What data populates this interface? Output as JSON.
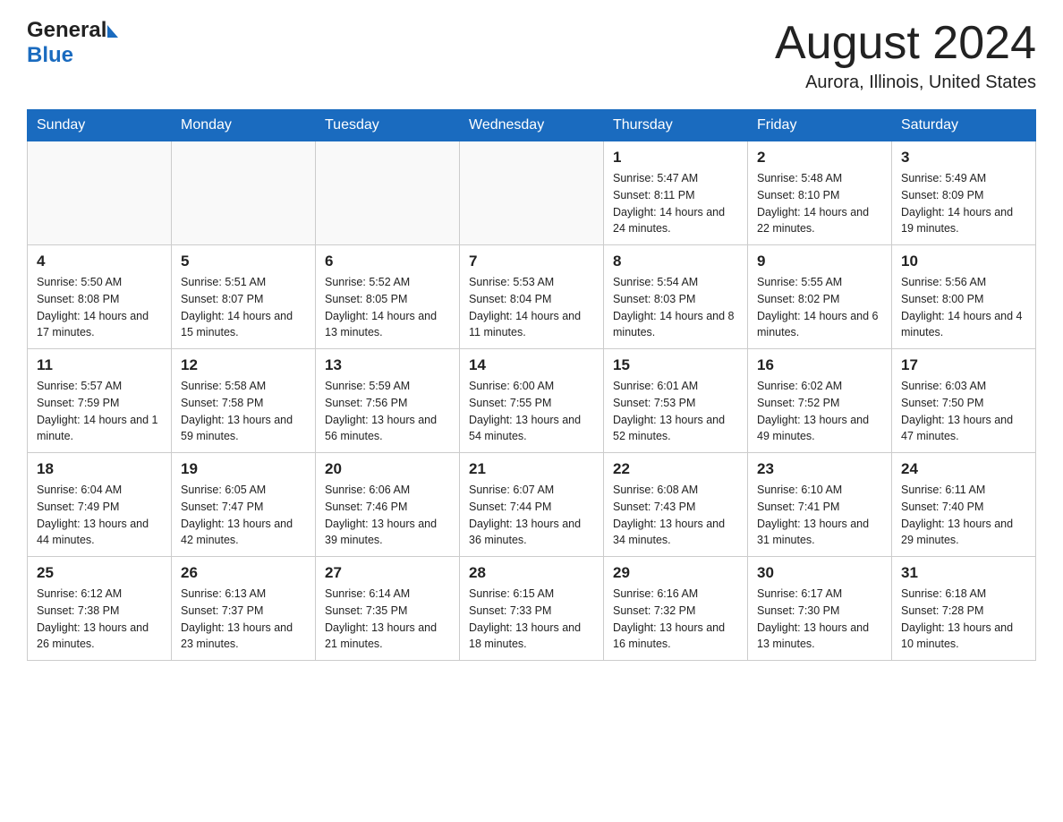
{
  "header": {
    "logo_general": "General",
    "logo_blue": "Blue",
    "month_title": "August 2024",
    "location": "Aurora, Illinois, United States"
  },
  "days_of_week": [
    "Sunday",
    "Monday",
    "Tuesday",
    "Wednesday",
    "Thursday",
    "Friday",
    "Saturday"
  ],
  "weeks": [
    {
      "days": [
        {
          "number": "",
          "info": ""
        },
        {
          "number": "",
          "info": ""
        },
        {
          "number": "",
          "info": ""
        },
        {
          "number": "",
          "info": ""
        },
        {
          "number": "1",
          "info": "Sunrise: 5:47 AM\nSunset: 8:11 PM\nDaylight: 14 hours and 24 minutes."
        },
        {
          "number": "2",
          "info": "Sunrise: 5:48 AM\nSunset: 8:10 PM\nDaylight: 14 hours and 22 minutes."
        },
        {
          "number": "3",
          "info": "Sunrise: 5:49 AM\nSunset: 8:09 PM\nDaylight: 14 hours and 19 minutes."
        }
      ]
    },
    {
      "days": [
        {
          "number": "4",
          "info": "Sunrise: 5:50 AM\nSunset: 8:08 PM\nDaylight: 14 hours and 17 minutes."
        },
        {
          "number": "5",
          "info": "Sunrise: 5:51 AM\nSunset: 8:07 PM\nDaylight: 14 hours and 15 minutes."
        },
        {
          "number": "6",
          "info": "Sunrise: 5:52 AM\nSunset: 8:05 PM\nDaylight: 14 hours and 13 minutes."
        },
        {
          "number": "7",
          "info": "Sunrise: 5:53 AM\nSunset: 8:04 PM\nDaylight: 14 hours and 11 minutes."
        },
        {
          "number": "8",
          "info": "Sunrise: 5:54 AM\nSunset: 8:03 PM\nDaylight: 14 hours and 8 minutes."
        },
        {
          "number": "9",
          "info": "Sunrise: 5:55 AM\nSunset: 8:02 PM\nDaylight: 14 hours and 6 minutes."
        },
        {
          "number": "10",
          "info": "Sunrise: 5:56 AM\nSunset: 8:00 PM\nDaylight: 14 hours and 4 minutes."
        }
      ]
    },
    {
      "days": [
        {
          "number": "11",
          "info": "Sunrise: 5:57 AM\nSunset: 7:59 PM\nDaylight: 14 hours and 1 minute."
        },
        {
          "number": "12",
          "info": "Sunrise: 5:58 AM\nSunset: 7:58 PM\nDaylight: 13 hours and 59 minutes."
        },
        {
          "number": "13",
          "info": "Sunrise: 5:59 AM\nSunset: 7:56 PM\nDaylight: 13 hours and 56 minutes."
        },
        {
          "number": "14",
          "info": "Sunrise: 6:00 AM\nSunset: 7:55 PM\nDaylight: 13 hours and 54 minutes."
        },
        {
          "number": "15",
          "info": "Sunrise: 6:01 AM\nSunset: 7:53 PM\nDaylight: 13 hours and 52 minutes."
        },
        {
          "number": "16",
          "info": "Sunrise: 6:02 AM\nSunset: 7:52 PM\nDaylight: 13 hours and 49 minutes."
        },
        {
          "number": "17",
          "info": "Sunrise: 6:03 AM\nSunset: 7:50 PM\nDaylight: 13 hours and 47 minutes."
        }
      ]
    },
    {
      "days": [
        {
          "number": "18",
          "info": "Sunrise: 6:04 AM\nSunset: 7:49 PM\nDaylight: 13 hours and 44 minutes."
        },
        {
          "number": "19",
          "info": "Sunrise: 6:05 AM\nSunset: 7:47 PM\nDaylight: 13 hours and 42 minutes."
        },
        {
          "number": "20",
          "info": "Sunrise: 6:06 AM\nSunset: 7:46 PM\nDaylight: 13 hours and 39 minutes."
        },
        {
          "number": "21",
          "info": "Sunrise: 6:07 AM\nSunset: 7:44 PM\nDaylight: 13 hours and 36 minutes."
        },
        {
          "number": "22",
          "info": "Sunrise: 6:08 AM\nSunset: 7:43 PM\nDaylight: 13 hours and 34 minutes."
        },
        {
          "number": "23",
          "info": "Sunrise: 6:10 AM\nSunset: 7:41 PM\nDaylight: 13 hours and 31 minutes."
        },
        {
          "number": "24",
          "info": "Sunrise: 6:11 AM\nSunset: 7:40 PM\nDaylight: 13 hours and 29 minutes."
        }
      ]
    },
    {
      "days": [
        {
          "number": "25",
          "info": "Sunrise: 6:12 AM\nSunset: 7:38 PM\nDaylight: 13 hours and 26 minutes."
        },
        {
          "number": "26",
          "info": "Sunrise: 6:13 AM\nSunset: 7:37 PM\nDaylight: 13 hours and 23 minutes."
        },
        {
          "number": "27",
          "info": "Sunrise: 6:14 AM\nSunset: 7:35 PM\nDaylight: 13 hours and 21 minutes."
        },
        {
          "number": "28",
          "info": "Sunrise: 6:15 AM\nSunset: 7:33 PM\nDaylight: 13 hours and 18 minutes."
        },
        {
          "number": "29",
          "info": "Sunrise: 6:16 AM\nSunset: 7:32 PM\nDaylight: 13 hours and 16 minutes."
        },
        {
          "number": "30",
          "info": "Sunrise: 6:17 AM\nSunset: 7:30 PM\nDaylight: 13 hours and 13 minutes."
        },
        {
          "number": "31",
          "info": "Sunrise: 6:18 AM\nSunset: 7:28 PM\nDaylight: 13 hours and 10 minutes."
        }
      ]
    }
  ]
}
